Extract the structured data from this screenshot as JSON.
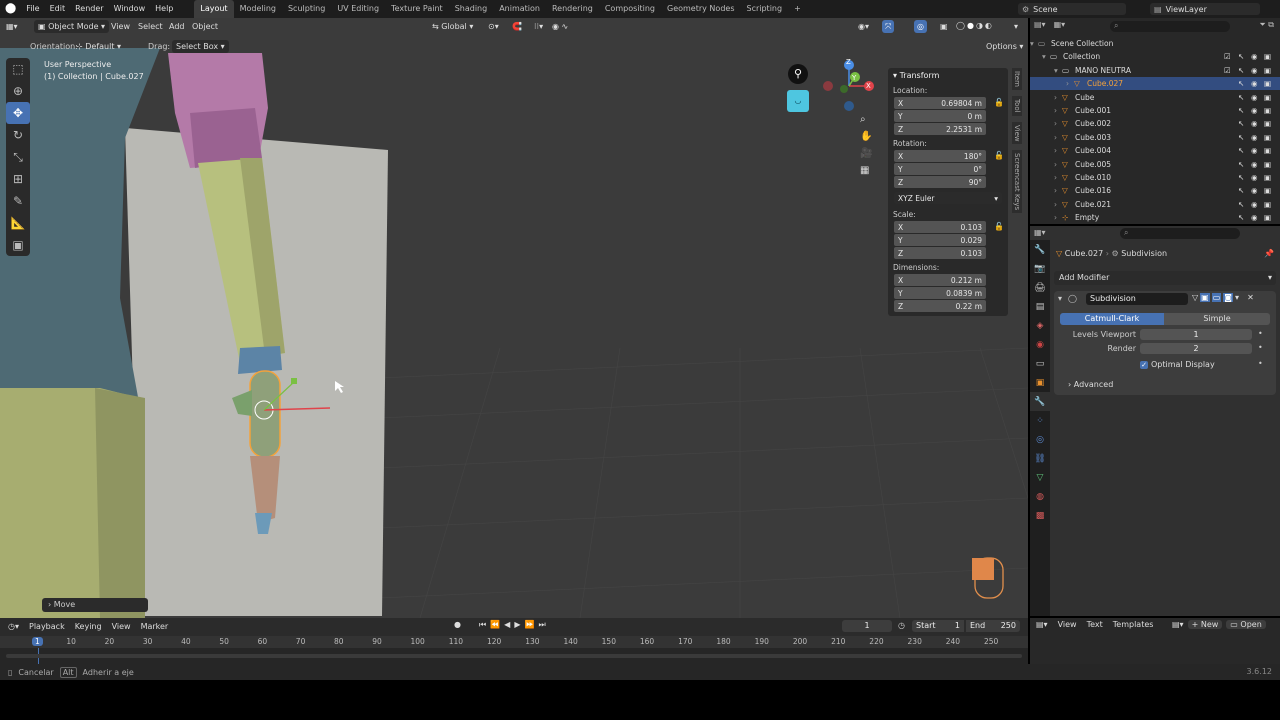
{
  "menu": {
    "items": [
      "File",
      "Edit",
      "Render",
      "Window",
      "Help"
    ],
    "workspaces": [
      "Layout",
      "Modeling",
      "Sculpting",
      "UV Editing",
      "Texture Paint",
      "Shading",
      "Animation",
      "Rendering",
      "Compositing",
      "Geometry Nodes",
      "Scripting"
    ],
    "add_tab": "+",
    "scene": "Scene",
    "view_layer": "ViewLayer"
  },
  "viewport": {
    "mode": "Object Mode",
    "menus": [
      "View",
      "Select",
      "Add",
      "Object"
    ],
    "transform_orientation": "Global",
    "orientation_label": "Orientation:",
    "orientation_value": "Default",
    "drag_label": "Drag:",
    "drag_value": "Select Box",
    "options": "Options",
    "perspective": "User Perspective",
    "collection_info": "(1) Collection | Cube.027",
    "operator_panel": "Move"
  },
  "gizmo": {
    "x": "X",
    "y": "Y",
    "z": "Z"
  },
  "npanel": {
    "section": "Transform",
    "location_label": "Location:",
    "location": [
      {
        "axis": "X",
        "value": "0.69804 m"
      },
      {
        "axis": "Y",
        "value": "0 m"
      },
      {
        "axis": "Z",
        "value": "2.2531 m"
      }
    ],
    "rotation_label": "Rotation:",
    "rotation": [
      {
        "axis": "X",
        "value": "180°"
      },
      {
        "axis": "Y",
        "value": "0°"
      },
      {
        "axis": "Z",
        "value": "90°"
      }
    ],
    "rotation_mode": "XYZ Euler",
    "scale_label": "Scale:",
    "scale": [
      {
        "axis": "X",
        "value": "0.103"
      },
      {
        "axis": "Y",
        "value": "0.029"
      },
      {
        "axis": "Z",
        "value": "0.103"
      }
    ],
    "dimensions_label": "Dimensions:",
    "dimensions": [
      {
        "axis": "X",
        "value": "0.212 m"
      },
      {
        "axis": "Y",
        "value": "0.0839 m"
      },
      {
        "axis": "Z",
        "value": "0.22 m"
      }
    ],
    "tabs": [
      "Item",
      "Tool",
      "View",
      "Screencast Keys"
    ]
  },
  "outliner": {
    "rows": [
      {
        "name": "Scene Collection",
        "indent": 0
      },
      {
        "name": "Collection",
        "indent": 1
      },
      {
        "name": "MANO NEUTRA",
        "indent": 2
      },
      {
        "name": "Cube.027",
        "indent": 3,
        "selected": true
      },
      {
        "name": "Cube",
        "indent": 2
      },
      {
        "name": "Cube.001",
        "indent": 2
      },
      {
        "name": "Cube.002",
        "indent": 2
      },
      {
        "name": "Cube.003",
        "indent": 2
      },
      {
        "name": "Cube.004",
        "indent": 2
      },
      {
        "name": "Cube.005",
        "indent": 2
      },
      {
        "name": "Cube.010",
        "indent": 2
      },
      {
        "name": "Cube.016",
        "indent": 2
      },
      {
        "name": "Cube.021",
        "indent": 2
      },
      {
        "name": "Empty",
        "indent": 2
      }
    ]
  },
  "properties": {
    "breadcrumb_object": "Cube.027",
    "breadcrumb_modifier": "Subdivision",
    "add_modifier": "Add Modifier",
    "modifier_name": "Subdivision",
    "algo_catmull": "Catmull-Clark",
    "algo_simple": "Simple",
    "levels_viewport_label": "Levels Viewport",
    "levels_viewport": "1",
    "render_label": "Render",
    "render_value": "2",
    "optimal_display": "Optimal Display",
    "advanced": "Advanced"
  },
  "timeline": {
    "menus": [
      "Playback",
      "Keying",
      "View",
      "Marker"
    ],
    "current_frame": "1",
    "start_label": "Start",
    "start": "1",
    "end_label": "End",
    "end": "250",
    "ticks": [
      "1",
      "10",
      "20",
      "30",
      "40",
      "50",
      "60",
      "70",
      "80",
      "90",
      "100",
      "110",
      "120",
      "130",
      "140",
      "150",
      "160",
      "170",
      "180",
      "190",
      "200",
      "210",
      "220",
      "230",
      "240",
      "250"
    ]
  },
  "text_editor": {
    "menus": [
      "View",
      "Text",
      "Templates"
    ],
    "new": "New",
    "open": "Open"
  },
  "status": {
    "cancel": "Cancelar",
    "alt": "Alt",
    "adherir": "Adherir a eje",
    "version": "3.6.12"
  },
  "colors": {
    "accent": "#4772b3",
    "selected_outline": "#f4a23b",
    "background": "#3b3b3b"
  }
}
